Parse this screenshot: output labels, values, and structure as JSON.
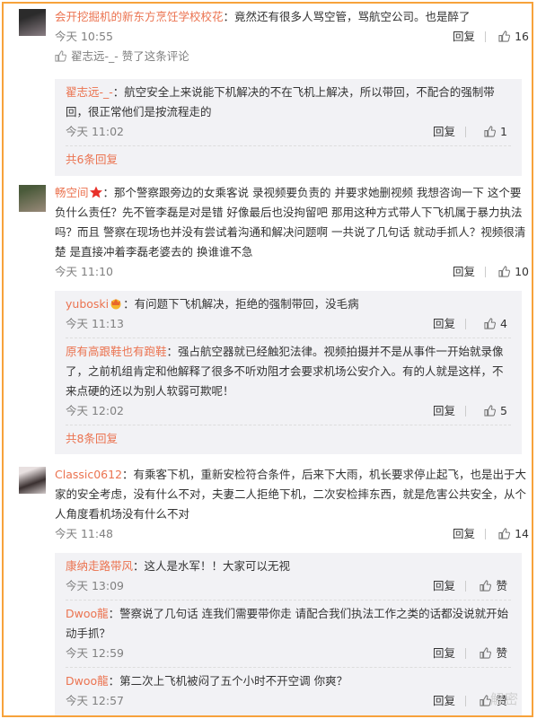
{
  "comments": [
    {
      "user": "会开挖掘机的新东方烹饪学校校花",
      "text": "：竟然还有很多人骂空管，骂航空公司。也是醉了",
      "time": "今天 10:55",
      "reply": "回复",
      "likes": "16",
      "liked_by": "翟志远-_-",
      "liked_by_suffix": " 赞了这条评论",
      "replies": [
        {
          "user": "翟志远-_-",
          "text": "：航空安全上来说能下机解决的不在飞机上解决，所以带回，不配合的强制带回，很正常他们是按流程走的",
          "time": "今天 11:02",
          "reply": "回复",
          "likes": "1"
        }
      ],
      "more": "共6条回复"
    },
    {
      "user": "畅空间",
      "text": "：那个警察跟旁边的女乘客说 录视频要负责的 并要求她删视频 我想咨询一下 这个要负什么责任？先不管李磊是对是错 好像最后也没拘留吧 那用这种方式带人下飞机属于暴力执法吗？而且 警察在现场也并没有尝试着沟通和解决问题啊 一共说了几句话 就动手抓人？视频很清楚 是直接冲着李磊老婆去的 换谁谁不急",
      "time": "今天 11:10",
      "reply": "回复",
      "likes": "10",
      "replies": [
        {
          "user": "yuboski",
          "text": "：有问题下飞机解决，拒绝的强制带回，没毛病",
          "time": "今天 11:13",
          "reply": "回复",
          "likes": "4"
        },
        {
          "user": "原有高跟鞋也有跑鞋",
          "text": "：强占航空器就已经触犯法律。视频拍摄并不是从事件一开始就录像了，之前机组肯定和他解释了很多不听劝阻才会要求机场公安介入。有的人就是这样，不来点硬的还以为别人软弱可欺呢！",
          "time": "今天 12:02",
          "reply": "回复",
          "likes": "5"
        }
      ],
      "more": "共8条回复"
    },
    {
      "user": "Classic0612",
      "text": "：有乘客下机，重新安检符合条件，后来下大雨，机长要求停止起飞，也是出于大家的安全考虑，没有什么不对，夫妻二人拒绝下机，二次安检摔东西，就是危害公共安全，从个人角度看机场没有什么不对",
      "time": "今天 11:48",
      "reply": "回复",
      "likes": "14",
      "replies": [
        {
          "user": "康纳走路带风",
          "text": "：这人是水军！！大家可以无视",
          "time": "今天 13:09",
          "reply": "回复",
          "likes": "赞"
        },
        {
          "user": "Dwoo龍",
          "text": "：警察说了几句话 连我们需要带你走 请配合我们执法工作之类的话都没说就开始动手抓？",
          "time": "今天 12:59",
          "reply": "回复",
          "likes": "赞"
        },
        {
          "user": "Dwoo龍",
          "text": "：第二次上飞机被闷了五个小时不开空调 你爽？",
          "time": "今天 12:57",
          "reply": "回复",
          "likes": "赞"
        }
      ]
    }
  ],
  "watermark": "解密",
  "colors": {
    "frame": "#f7a23b",
    "username": "#eb7350",
    "sub_bg": "#f2f2f5"
  }
}
